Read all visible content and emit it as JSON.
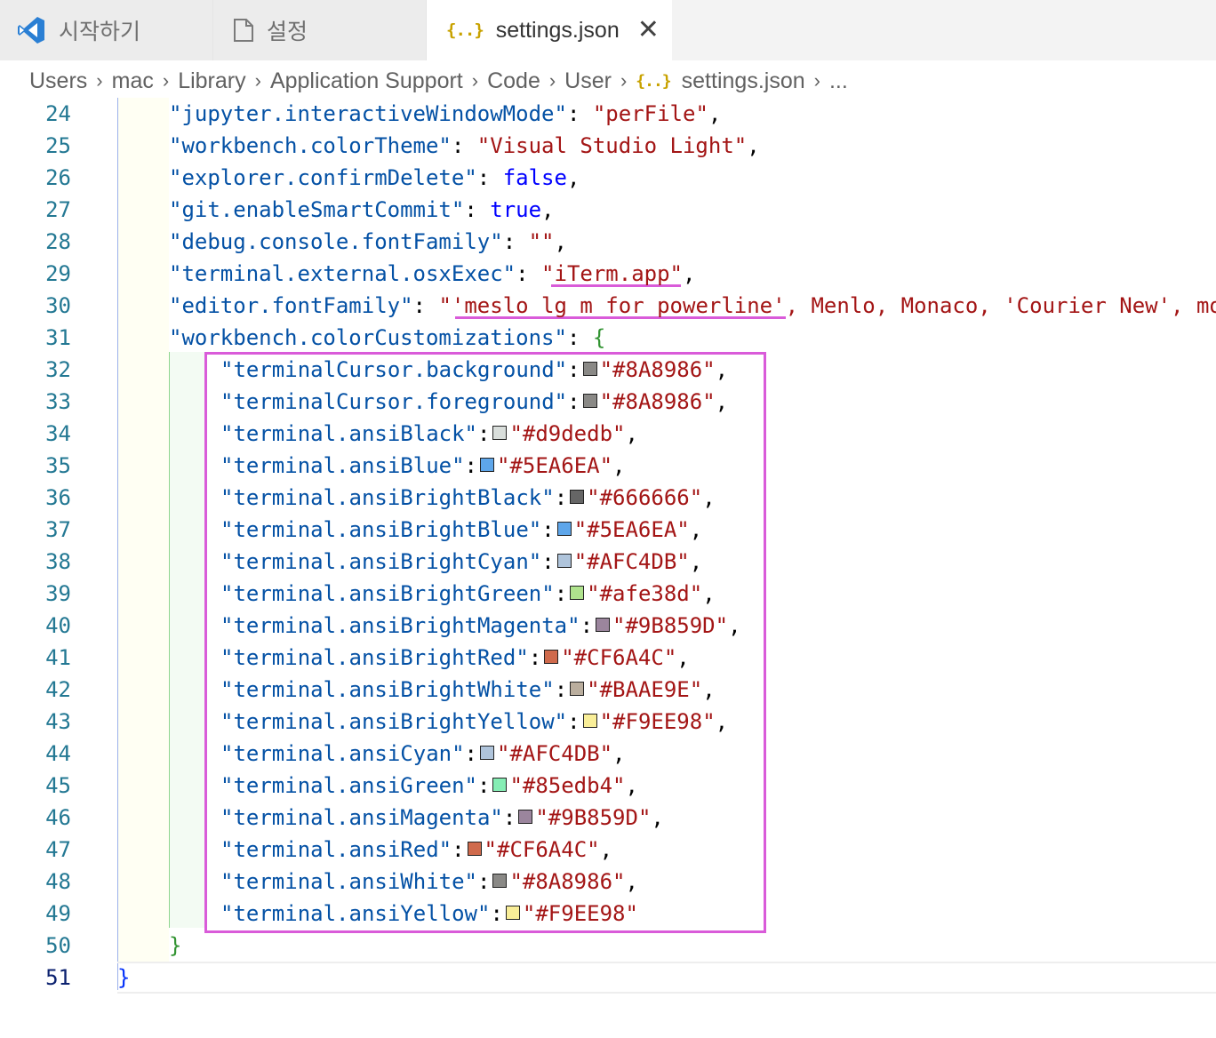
{
  "tabs": [
    {
      "label": "시작하기",
      "icon": "vscode-logo-icon"
    },
    {
      "label": "설정",
      "icon": "file-icon"
    },
    {
      "label": "settings.json",
      "icon": "json-braces-icon",
      "active": true,
      "close": "✕"
    }
  ],
  "breadcrumb": {
    "items": [
      "Users",
      "mac",
      "Library",
      "Application Support",
      "Code",
      "User",
      "settings.json"
    ],
    "more": "...",
    "separator": "›",
    "icon_glyph": "{..}"
  },
  "lines": [
    {
      "n": "24",
      "indent": 1,
      "key": "jupyter.interactiveWindowMode",
      "value": "perFile",
      "vtype": "string",
      "comma": true
    },
    {
      "n": "25",
      "indent": 1,
      "key": "workbench.colorTheme",
      "value": "Visual Studio Light",
      "vtype": "string",
      "comma": true
    },
    {
      "n": "26",
      "indent": 1,
      "key": "explorer.confirmDelete",
      "value": "false",
      "vtype": "keyword",
      "comma": true
    },
    {
      "n": "27",
      "indent": 1,
      "key": "git.enableSmartCommit",
      "value": "true",
      "vtype": "keyword",
      "comma": true
    },
    {
      "n": "28",
      "indent": 1,
      "key": "debug.console.fontFamily",
      "value": "",
      "vtype": "string",
      "comma": true
    },
    {
      "n": "29",
      "indent": 1,
      "key": "terminal.external.osxExec",
      "value": "iTerm.app",
      "vtype": "string",
      "comma": true
    },
    {
      "n": "30",
      "indent": 1,
      "key": "editor.fontFamily",
      "value": "'meslo lg m for powerline', Menlo, Monaco, 'Courier New', monospace",
      "vtype": "string",
      "comma": true
    },
    {
      "n": "31",
      "indent": 1,
      "key": "workbench.colorCustomizations",
      "vtype": "open"
    },
    {
      "n": "32",
      "indent": 2,
      "key": "terminalCursor.background",
      "value": "#8A8986",
      "vtype": "color",
      "comma": true
    },
    {
      "n": "33",
      "indent": 2,
      "key": "terminalCursor.foreground",
      "value": "#8A8986",
      "vtype": "color",
      "comma": true
    },
    {
      "n": "34",
      "indent": 2,
      "key": "terminal.ansiBlack",
      "value": "#d9dedb",
      "vtype": "color",
      "comma": true
    },
    {
      "n": "35",
      "indent": 2,
      "key": "terminal.ansiBlue",
      "value": "#5EA6EA",
      "vtype": "color",
      "comma": true
    },
    {
      "n": "36",
      "indent": 2,
      "key": "terminal.ansiBrightBlack",
      "value": "#666666",
      "vtype": "color",
      "comma": true
    },
    {
      "n": "37",
      "indent": 2,
      "key": "terminal.ansiBrightBlue",
      "value": "#5EA6EA",
      "vtype": "color",
      "comma": true
    },
    {
      "n": "38",
      "indent": 2,
      "key": "terminal.ansiBrightCyan",
      "value": "#AFC4DB",
      "vtype": "color",
      "comma": true
    },
    {
      "n": "39",
      "indent": 2,
      "key": "terminal.ansiBrightGreen",
      "value": "#afe38d",
      "vtype": "color",
      "comma": true
    },
    {
      "n": "40",
      "indent": 2,
      "key": "terminal.ansiBrightMagenta",
      "value": "#9B859D",
      "vtype": "color",
      "comma": true
    },
    {
      "n": "41",
      "indent": 2,
      "key": "terminal.ansiBrightRed",
      "value": "#CF6A4C",
      "vtype": "color",
      "comma": true
    },
    {
      "n": "42",
      "indent": 2,
      "key": "terminal.ansiBrightWhite",
      "value": "#BAAE9E",
      "vtype": "color",
      "comma": true
    },
    {
      "n": "43",
      "indent": 2,
      "key": "terminal.ansiBrightYellow",
      "value": "#F9EE98",
      "vtype": "color",
      "comma": true
    },
    {
      "n": "44",
      "indent": 2,
      "key": "terminal.ansiCyan",
      "value": "#AFC4DB",
      "vtype": "color",
      "comma": true
    },
    {
      "n": "45",
      "indent": 2,
      "key": "terminal.ansiGreen",
      "value": "#85edb4",
      "vtype": "color",
      "comma": true
    },
    {
      "n": "46",
      "indent": 2,
      "key": "terminal.ansiMagenta",
      "value": "#9B859D",
      "vtype": "color",
      "comma": true
    },
    {
      "n": "47",
      "indent": 2,
      "key": "terminal.ansiRed",
      "value": "#CF6A4C",
      "vtype": "color",
      "comma": true
    },
    {
      "n": "48",
      "indent": 2,
      "key": "terminal.ansiWhite",
      "value": "#8A8986",
      "vtype": "color",
      "comma": true
    },
    {
      "n": "49",
      "indent": 2,
      "key": "terminal.ansiYellow",
      "value": "#F9EE98",
      "vtype": "color",
      "comma": false
    },
    {
      "n": "50",
      "indent": 1,
      "vtype": "close",
      "text": "}"
    },
    {
      "n": "51",
      "indent": 0,
      "vtype": "close0",
      "text": "}",
      "current": true
    }
  ]
}
